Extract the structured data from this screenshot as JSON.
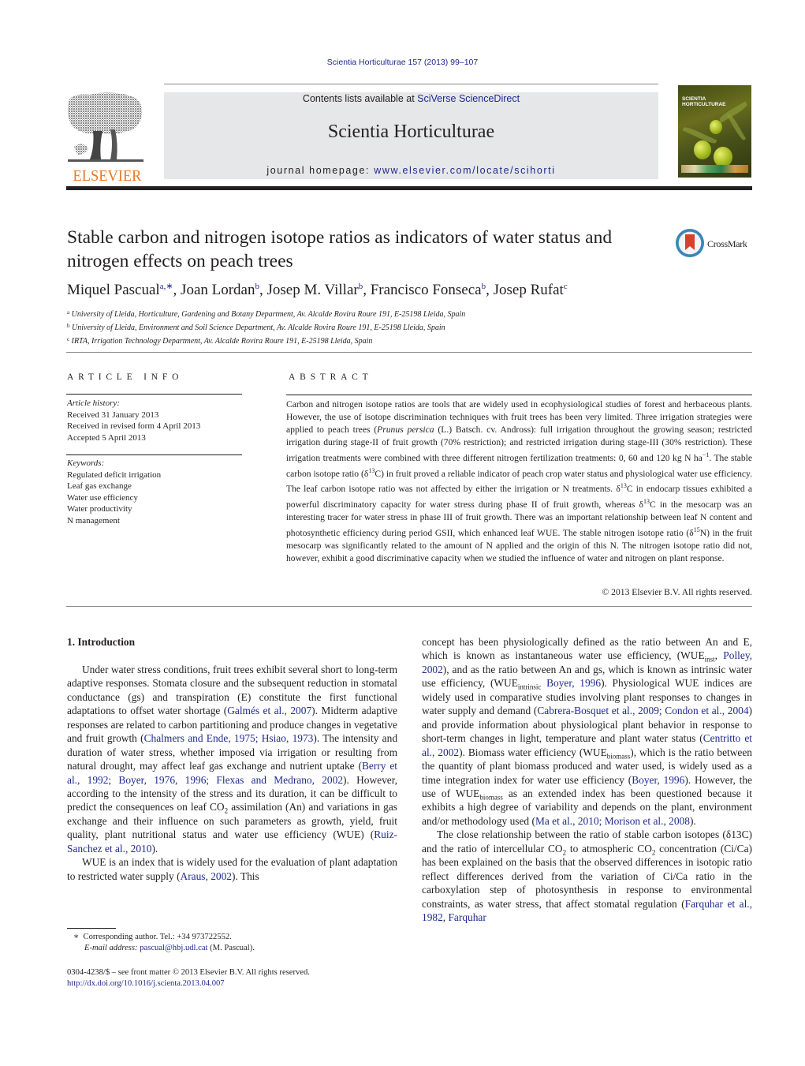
{
  "header": {
    "journal_reference": "Scientia Horticulturae 157 (2013) 99–107",
    "contents_prefix": "Contents lists available at ",
    "contents_link": "SciVerse ScienceDirect",
    "journal_title": "Scientia Horticulturae",
    "homepage_prefix": "journal homepage: ",
    "homepage_link": "www.elsevier.com/locate/scihorti",
    "publisher_logo_text": "ELSEVIER",
    "cover_title_line1": "SCIENTIA",
    "cover_title_line2": "HORTICULTURAE",
    "crossmark_label": "CrossMark"
  },
  "article": {
    "title": "Stable carbon and nitrogen isotope ratios as indicators of water status and nitrogen effects on peach trees",
    "authors": [
      {
        "name": "Miquel Pascual",
        "sup": "a,∗"
      },
      {
        "name": "Joan Lordan",
        "sup": "b"
      },
      {
        "name": "Josep M. Villar",
        "sup": "b"
      },
      {
        "name": "Francisco Fonseca",
        "sup": "b"
      },
      {
        "name": "Josep Rufat",
        "sup": "c"
      }
    ],
    "affiliations": [
      {
        "mark": "a",
        "text": "University of Lleida, Horticulture, Gardening and Botany Department, Av. Alcalde Rovira Roure 191, E-25198 Lleida, Spain"
      },
      {
        "mark": "b",
        "text": "University of Lleida, Environment and Soil Science Department, Av. Alcalde Rovira Roure 191, E-25198 Lleida, Spain"
      },
      {
        "mark": "c",
        "text": "IRTA, Irrigation Technology Department, Av. Alcalde Rovira Roure 191, E-25198 Lleida, Spain"
      }
    ]
  },
  "article_info": {
    "heading": "ARTICLE INFO",
    "history_label": "Article history:",
    "history": [
      "Received 31 January 2013",
      "Received in revised form 4 April 2013",
      "Accepted 5 April 2013"
    ],
    "keywords_label": "Keywords:",
    "keywords": [
      "Regulated deficit irrigation",
      "Leaf gas exchange",
      "Water use efficiency",
      "Water productivity",
      "N management"
    ]
  },
  "abstract": {
    "heading": "ABSTRACT",
    "p1": "Carbon and nitrogen isotope ratios are tools that are widely used in ecophysiological studies of forest and herbaceous plants. However, the use of isotope discrimination techniques with fruit trees has been very limited. Three irrigation strategies were applied to peach trees (",
    "species": "Prunus persica",
    "p2": " (L.) Batsch. cv. Andross): full irrigation throughout the growing season; restricted irrigation during stage-II of fruit growth (70% restriction); and restricted irrigation during stage-III (30% restriction). These irrigation treatments were combined with three different nitrogen fertilization treatments: 0, 60 and 120 kg N ha",
    "p2_sup": "−1",
    "p3": ". The stable carbon isotope ratio (δ",
    "sup13": "13",
    "p4": "C) in fruit proved a reliable indicator of peach crop water status and physiological water use efficiency. The leaf carbon isotope ratio was not affected by either the irrigation or N treatments. δ",
    "p5": "C in endocarp tissues exhibited a powerful discriminatory capacity for water stress during phase II of fruit growth, whereas δ",
    "p6": "C in the mesocarp was an interesting tracer for water stress in phase III of fruit growth. There was an important relationship between leaf N content and photosynthetic efficiency during period GSII, which enhanced leaf WUE. The stable nitrogen isotope ratio (δ",
    "sup15": "15",
    "p7": "N) in the fruit mesocarp was significantly related to the amount of N applied and the origin of this N. The nitrogen isotope ratio did not, however, exhibit a good discriminative capacity when we studied the influence of water and nitrogen on plant response.",
    "copyright": "© 2013 Elsevier B.V. All rights reserved."
  },
  "introduction": {
    "heading": "1.  Introduction",
    "left": {
      "a": "Under water stress conditions, fruit trees exhibit several short to long-term adaptive responses. Stomata closure and the subsequent reduction in stomatal conductance (gs) and transpiration (E) constitute the first functional adaptations to offset water shortage (",
      "ref1": "Galmés et al., 2007",
      "b": "). Midterm adaptive responses are related to carbon partitioning and produce changes in vegetative and fruit growth (",
      "ref2": "Chalmers and Ende, 1975; Hsiao, 1973",
      "c": "). The intensity and duration of water stress, whether imposed via irrigation or resulting from natural drought, may affect leaf gas exchange and nutrient uptake (",
      "ref3": "Berry et al., 1992; Boyer, 1976, 1996; Flexas and Medrano, 2002",
      "d": "). However, according to the intensity of the stress and its duration, it can be difficult to predict the consequences on leaf CO",
      "sub2": "2",
      "e": " assimilation (An) and variations in gas exchange and their influence on such parameters as growth, yield, fruit quality, plant nutritional status and water use efficiency (WUE) (",
      "ref4": "Ruiz-Sanchez et al., 2010",
      "f": ").",
      "p2a": "WUE is an index that is widely used for the evaluation of plant adaptation to restricted water supply (",
      "ref5": "Araus, 2002",
      "p2b": "). This"
    },
    "right": {
      "a": "concept has been physiologically defined as the ratio between An and E, which is known as instantaneous water use efficiency, (WUE",
      "sub_inst": "inst",
      "b": ", ",
      "ref1": "Polley, 2002",
      "c": "), and as the ratio between An and gs, which is known as intrinsic water use efficiency, (WUE",
      "sub_intrinsic": "intrinsic",
      "d": " ",
      "ref2": "Boyer, 1996",
      "e": "). Physiological WUE indices are widely used in comparative studies involving plant responses to changes in water supply and demand (",
      "ref3": "Cabrera-Bosquet et al., 2009; Condon et al., 2004",
      "f": ") and provide information about physiological plant behavior in response to short-term changes in light, temperature and plant water status (",
      "ref4": "Centritto et al., 2002",
      "g": "). Biomass water efficiency (WUE",
      "sub_biomass": "biomass",
      "h": "), which is the ratio between the quantity of plant biomass produced and water used, is widely used as a time integration index for water use efficiency (",
      "ref5": "Boyer, 1996",
      "i": "). However, the use of WUE",
      "j": " as an extended index has been questioned because it exhibits a high degree of variability and depends on the plant, environment and/or methodology used (",
      "ref6": "Ma et al., 2010; Morison et al., 2008",
      "k": ").",
      "p2a": "The close relationship between the ratio of stable carbon isotopes (δ13C) and the ratio of intercellular CO",
      "sub2": "2",
      "p2b": " to atmospheric CO",
      "p2c": " concentration (Ci/Ca) has been explained on the basis that the observed differences in isotopic ratio reflect differences derived from the variation of Ci/Ca ratio in the carboxylation step of photosynthesis in response to environmental constraints, as water stress, that affect stomatal regulation (",
      "ref7": "Farquhar et al., 1982",
      "p2d": ", ",
      "ref8": "Farquhar"
    }
  },
  "footnotes": {
    "star": "∗",
    "corresponding": "Corresponding author. Tel.: +34 973722552.",
    "email_label": "E-mail address:",
    "email": "pascual@hbj.udl.cat",
    "email_suffix": " (M. Pascual).",
    "front_matter": "0304-4238/$ – see front matter © 2013 Elsevier B.V. All rights reserved.",
    "doi": "http://dx.doi.org/10.1016/j.scienta.2013.04.007"
  },
  "colors": {
    "link": "#1f2a8c",
    "elsevier_orange": "#e87722",
    "banner_bg": "#e6e7e8"
  }
}
